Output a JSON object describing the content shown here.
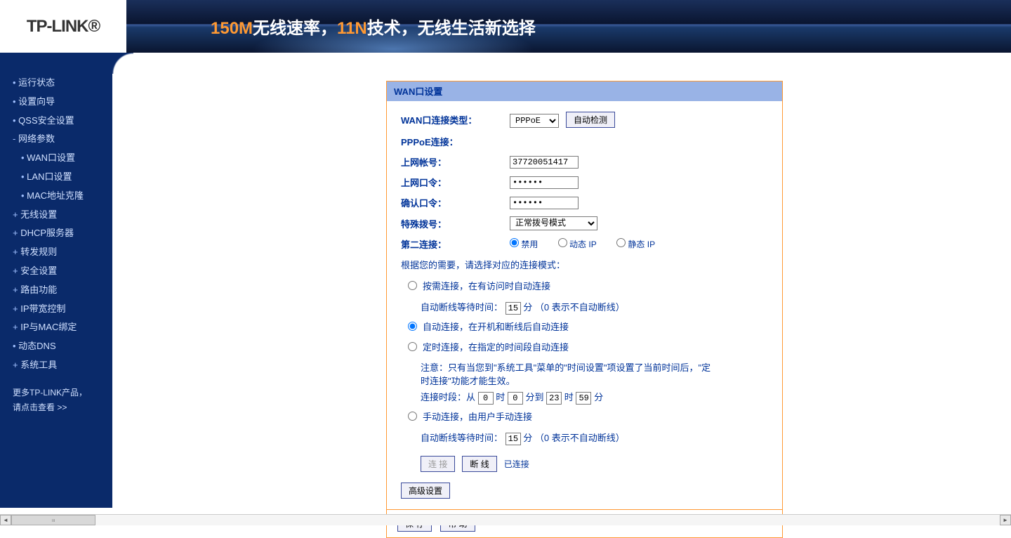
{
  "header": {
    "logo": "TP-LINK®",
    "banner_part1": "150M",
    "banner_part2": "无线速率，",
    "banner_part3": "11N",
    "banner_part4": "技术，无线生活新选择"
  },
  "sidebar": {
    "items": [
      {
        "label": "运行状态",
        "type": "item"
      },
      {
        "label": "设置向导",
        "type": "item"
      },
      {
        "label": "QSS安全设置",
        "type": "item"
      },
      {
        "label": "网络参数",
        "type": "expanded"
      },
      {
        "label": "WAN口设置",
        "type": "sub"
      },
      {
        "label": "LAN口设置",
        "type": "sub"
      },
      {
        "label": "MAC地址克隆",
        "type": "sub"
      },
      {
        "label": "无线设置",
        "type": "expandable"
      },
      {
        "label": "DHCP服务器",
        "type": "expandable"
      },
      {
        "label": "转发规则",
        "type": "expandable"
      },
      {
        "label": "安全设置",
        "type": "expandable"
      },
      {
        "label": "路由功能",
        "type": "expandable"
      },
      {
        "label": "IP带宽控制",
        "type": "expandable"
      },
      {
        "label": "IP与MAC绑定",
        "type": "expandable"
      },
      {
        "label": "动态DNS",
        "type": "item"
      },
      {
        "label": "系统工具",
        "type": "expandable"
      }
    ],
    "more_line1": "更多TP-LINK产品，",
    "more_line2": "请点击查看 >>"
  },
  "panel": {
    "title": "WAN口设置",
    "conn_type_label": "WAN口连接类型：",
    "conn_type_value": "PPPoE",
    "auto_detect": "自动检测",
    "pppoe_label": "PPPoE连接：",
    "username_label": "上网帐号：",
    "username_value": "37720051417",
    "password_label": "上网口令：",
    "password_value": "••••••",
    "confirm_label": "确认口令：",
    "confirm_value": "••••••",
    "special_label": "特殊拨号：",
    "special_value": "正常拨号模式",
    "second_conn_label": "第二连接：",
    "radio_disable": "禁用",
    "radio_dynip": "动态 IP",
    "radio_staticip": "静态 IP",
    "mode_intro": "根据您的需要，请选择对应的连接模式：",
    "mode1": "按需连接，在有访问时自动连接",
    "mode1_sub_prefix": "自动断线等待时间：",
    "mode1_sub_value": "15",
    "mode1_sub_suffix": "分 （0 表示不自动断线）",
    "mode2": "自动连接，在开机和断线后自动连接",
    "mode3": "定时连接，在指定的时间段自动连接",
    "mode3_note": "注意：只有当您到\"系统工具\"菜单的\"时间设置\"项设置了当前时间后，\"定时连接\"功能才能生效。",
    "mode3_range_prefix": "连接时段：从",
    "mode3_h1": "0",
    "mode3_unit_h": "时",
    "mode3_m1": "0",
    "mode3_unit_m": "分到",
    "mode3_h2": "23",
    "mode3_m2": "59",
    "mode3_unit_m2": "分",
    "mode4": "手动连接，由用户手动连接",
    "mode4_sub_prefix": "自动断线等待时间：",
    "mode4_sub_value": "15",
    "mode4_sub_suffix": "分 （0 表示不自动断线）",
    "connect_btn": "连 接",
    "disconnect_btn": "断 线",
    "status": "已连接",
    "advanced_btn": "高级设置",
    "save_btn": "保 存",
    "help_btn": "帮 助"
  }
}
